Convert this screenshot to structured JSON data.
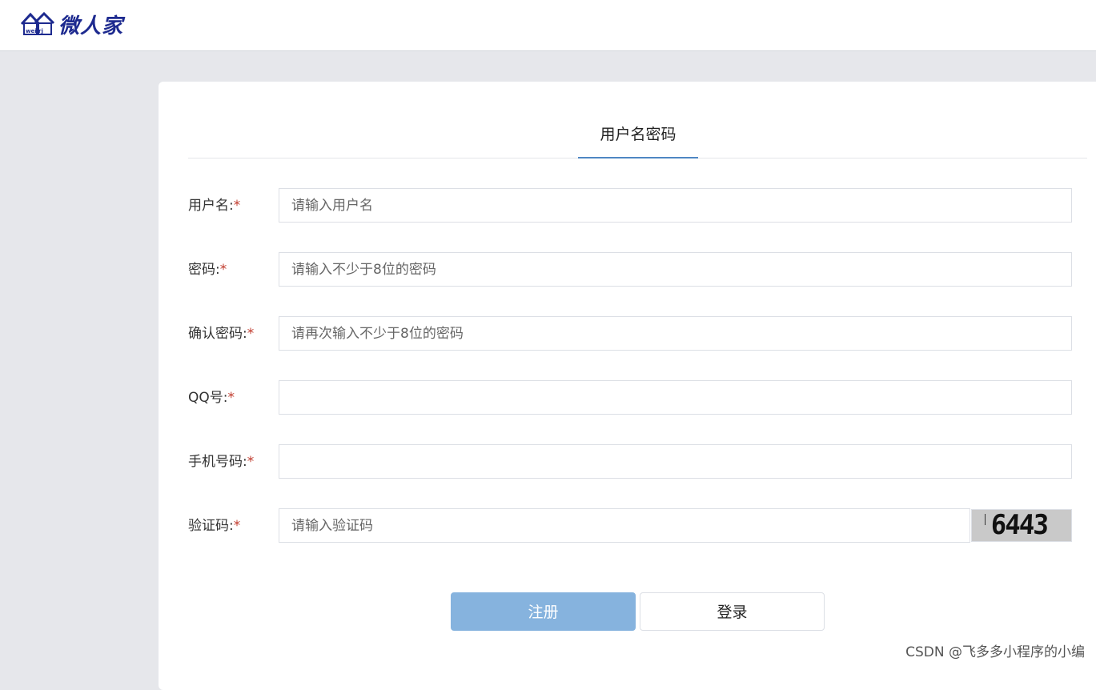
{
  "header": {
    "logo_text": "微人家",
    "logo_small_text": "wei rj"
  },
  "tabs": [
    {
      "label": "用户名密码",
      "active": true
    }
  ],
  "form": {
    "username": {
      "label": "用户名:",
      "required_mark": "*",
      "placeholder": "请输入用户名",
      "value": ""
    },
    "password": {
      "label": "密码:",
      "required_mark": "*",
      "placeholder": "请输入不少于8位的密码",
      "value": ""
    },
    "confirm_password": {
      "label": "确认密码:",
      "required_mark": "*",
      "placeholder": "请再次输入不少于8位的密码",
      "value": ""
    },
    "qq": {
      "label": "QQ号:",
      "required_mark": "*",
      "placeholder": "",
      "value": ""
    },
    "phone": {
      "label": "手机号码:",
      "required_mark": "*",
      "placeholder": "",
      "value": ""
    },
    "captcha": {
      "label": "验证码:",
      "required_mark": "*",
      "placeholder": "请输入验证码",
      "value": "",
      "image_text": "6443"
    }
  },
  "buttons": {
    "register": "注册",
    "login": "登录"
  },
  "watermark": "CSDN @飞多多小程序的小编",
  "colors": {
    "accent": "#4f87c3",
    "register_button": "#86b3de",
    "required": "#c0392b",
    "logo": "#1d2a8f",
    "background": "#e6e7eb"
  }
}
